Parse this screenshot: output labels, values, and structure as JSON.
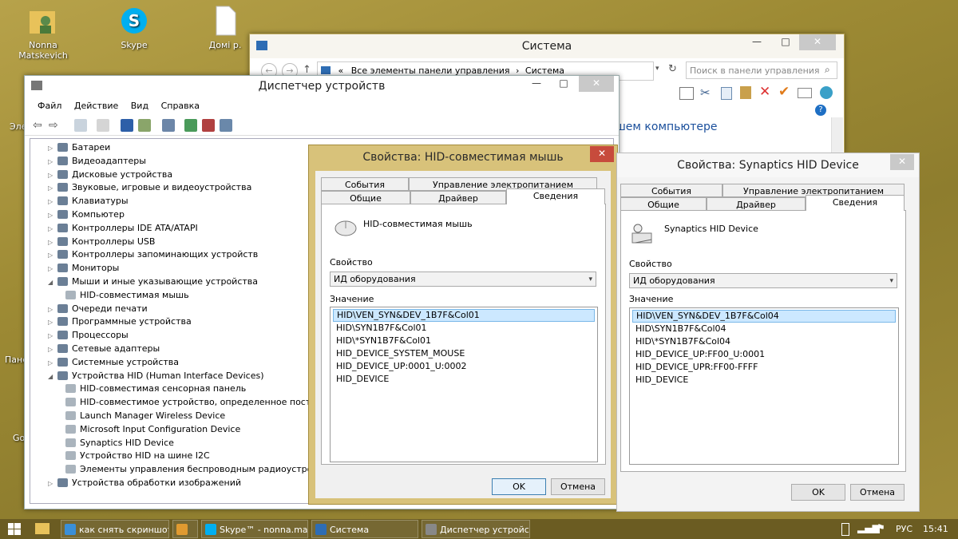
{
  "desktop": {
    "icons": [
      {
        "label": "Nonna Matskevich"
      },
      {
        "label": "Skype"
      },
      {
        "label": "Домi р."
      }
    ],
    "side_labels": [
      "Эле",
      "Пане",
      "Go"
    ]
  },
  "sistema": {
    "title": "Система",
    "address": {
      "root": "«",
      "crumb1": "Все элементы панели управления",
      "sep": "›",
      "crumb2": "Система"
    },
    "search_placeholder": "Поиск в панели управления",
    "content_fragment": "шем компьютере",
    "help": "?"
  },
  "devmgr": {
    "title": "Диспетчер устройств",
    "menu": [
      "Файл",
      "Действие",
      "Вид",
      "Справка"
    ],
    "tree": [
      {
        "label": "Батареи",
        "level": 0,
        "expanded": false
      },
      {
        "label": "Видеоадаптеры",
        "level": 0,
        "expanded": false
      },
      {
        "label": "Дисковые устройства",
        "level": 0,
        "expanded": false
      },
      {
        "label": "Звуковые, игровые и видеоустройства",
        "level": 0,
        "expanded": false
      },
      {
        "label": "Клавиатуры",
        "level": 0,
        "expanded": false
      },
      {
        "label": "Компьютер",
        "level": 0,
        "expanded": false
      },
      {
        "label": "Контроллеры IDE ATA/ATAPI",
        "level": 0,
        "expanded": false
      },
      {
        "label": "Контроллеры USB",
        "level": 0,
        "expanded": false
      },
      {
        "label": "Контроллеры запоминающих устройств",
        "level": 0,
        "expanded": false
      },
      {
        "label": "Мониторы",
        "level": 0,
        "expanded": false
      },
      {
        "label": "Мыши и иные указывающие устройства",
        "level": 0,
        "expanded": true
      },
      {
        "label": "HID-совместимая мышь",
        "level": 1
      },
      {
        "label": "Очереди печати",
        "level": 0,
        "expanded": false
      },
      {
        "label": "Программные устройства",
        "level": 0,
        "expanded": false
      },
      {
        "label": "Процессоры",
        "level": 0,
        "expanded": false
      },
      {
        "label": "Сетевые адаптеры",
        "level": 0,
        "expanded": false
      },
      {
        "label": "Системные устройства",
        "level": 0,
        "expanded": false
      },
      {
        "label": "Устройства HID (Human Interface Devices)",
        "level": 0,
        "expanded": true
      },
      {
        "label": "HID-совместимая сенсорная панель",
        "level": 1
      },
      {
        "label": "HID-совместимое устройство, определенное постав",
        "level": 1
      },
      {
        "label": "Launch Manager Wireless Device",
        "level": 1
      },
      {
        "label": "Microsoft Input Configuration Device",
        "level": 1
      },
      {
        "label": "Synaptics HID Device",
        "level": 1
      },
      {
        "label": "Устройство HID на шине I2C",
        "level": 1
      },
      {
        "label": "Элементы управления беспроводным радиоустрой",
        "level": 1
      },
      {
        "label": "Устройства обработки изображений",
        "level": 0,
        "expanded": false
      }
    ]
  },
  "hid_dialog": {
    "title": "Свойства: HID-совместимая мышь",
    "tabs_row1": [
      "События",
      "Управление электропитанием"
    ],
    "tabs_row2": [
      "Общие",
      "Драйвер",
      "Сведения"
    ],
    "device_name": "HID-совместимая мышь",
    "property_label": "Свойство",
    "property_value": "ИД оборудования",
    "value_label": "Значение",
    "values": [
      "HID\\VEN_SYN&DEV_1B7F&Col01",
      "HID\\SYN1B7F&Col01",
      "HID\\*SYN1B7F&Col01",
      "HID_DEVICE_SYSTEM_MOUSE",
      "HID_DEVICE_UP:0001_U:0002",
      "HID_DEVICE"
    ],
    "ok": "OK",
    "cancel": "Отмена"
  },
  "syn_dialog": {
    "title": "Свойства: Synaptics HID Device",
    "tabs_row1": [
      "События",
      "Управление электропитанием"
    ],
    "tabs_row2": [
      "Общие",
      "Драйвер",
      "Сведения"
    ],
    "device_name": "Synaptics HID Device",
    "property_label": "Свойство",
    "property_value": "ИД оборудования",
    "value_label": "Значение",
    "values": [
      "HID\\VEN_SYN&DEV_1B7F&Col04",
      "HID\\SYN1B7F&Col04",
      "HID\\*SYN1B7F&Col04",
      "HID_DEVICE_UP:FF00_U:0001",
      "HID_DEVICE_UPR:FF00-FFFF",
      "HID_DEVICE"
    ],
    "ok": "OK",
    "cancel": "Отмена"
  },
  "taskbar": {
    "items": [
      {
        "label": "как снять скриншот..."
      },
      {
        "label": ""
      },
      {
        "label": "Skype™ - nonna.ma..."
      },
      {
        "label": "Система"
      },
      {
        "label": "Диспетчер устройств"
      }
    ],
    "lang": "РУС",
    "time": "15:41"
  },
  "colors": {
    "close_red": "#c74b3c",
    "selection": "#cce8ff",
    "taskbar": "#6b5c22"
  }
}
